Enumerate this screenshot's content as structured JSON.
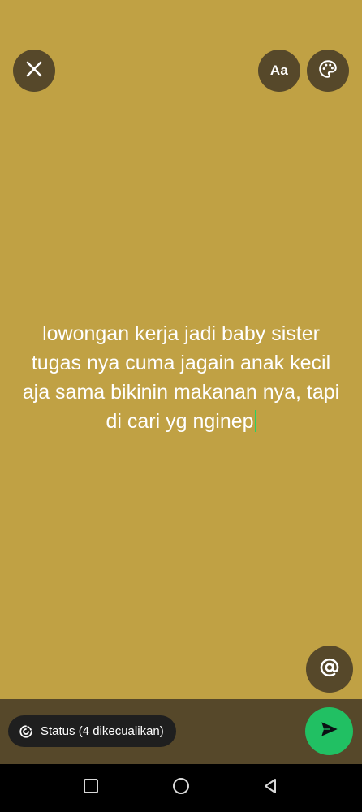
{
  "top_bar": {
    "close_icon": "close-icon",
    "font_button_label": "Aa",
    "palette_icon": "palette-icon"
  },
  "status": {
    "text": "lowongan kerja jadi baby sister\ntugas nya cuma jagain anak kecil\naja sama bikinin makanan nya, tapi\ndi cari yg nginep",
    "caret_color": "#25d366"
  },
  "mention": {
    "icon": "at-sign-icon"
  },
  "bottom_bar": {
    "audience_label": "Status (4 dikecualikan)",
    "audience_icon": "status-ring-icon",
    "send_icon": "send-icon",
    "send_color": "#21c063"
  },
  "nav": {
    "recents_icon": "square-icon",
    "home_icon": "circle-icon",
    "back_icon": "triangle-back-icon"
  },
  "colors": {
    "background": "#c0a144",
    "button_background": "#56482a",
    "pill_background": "#1f1f1f"
  }
}
